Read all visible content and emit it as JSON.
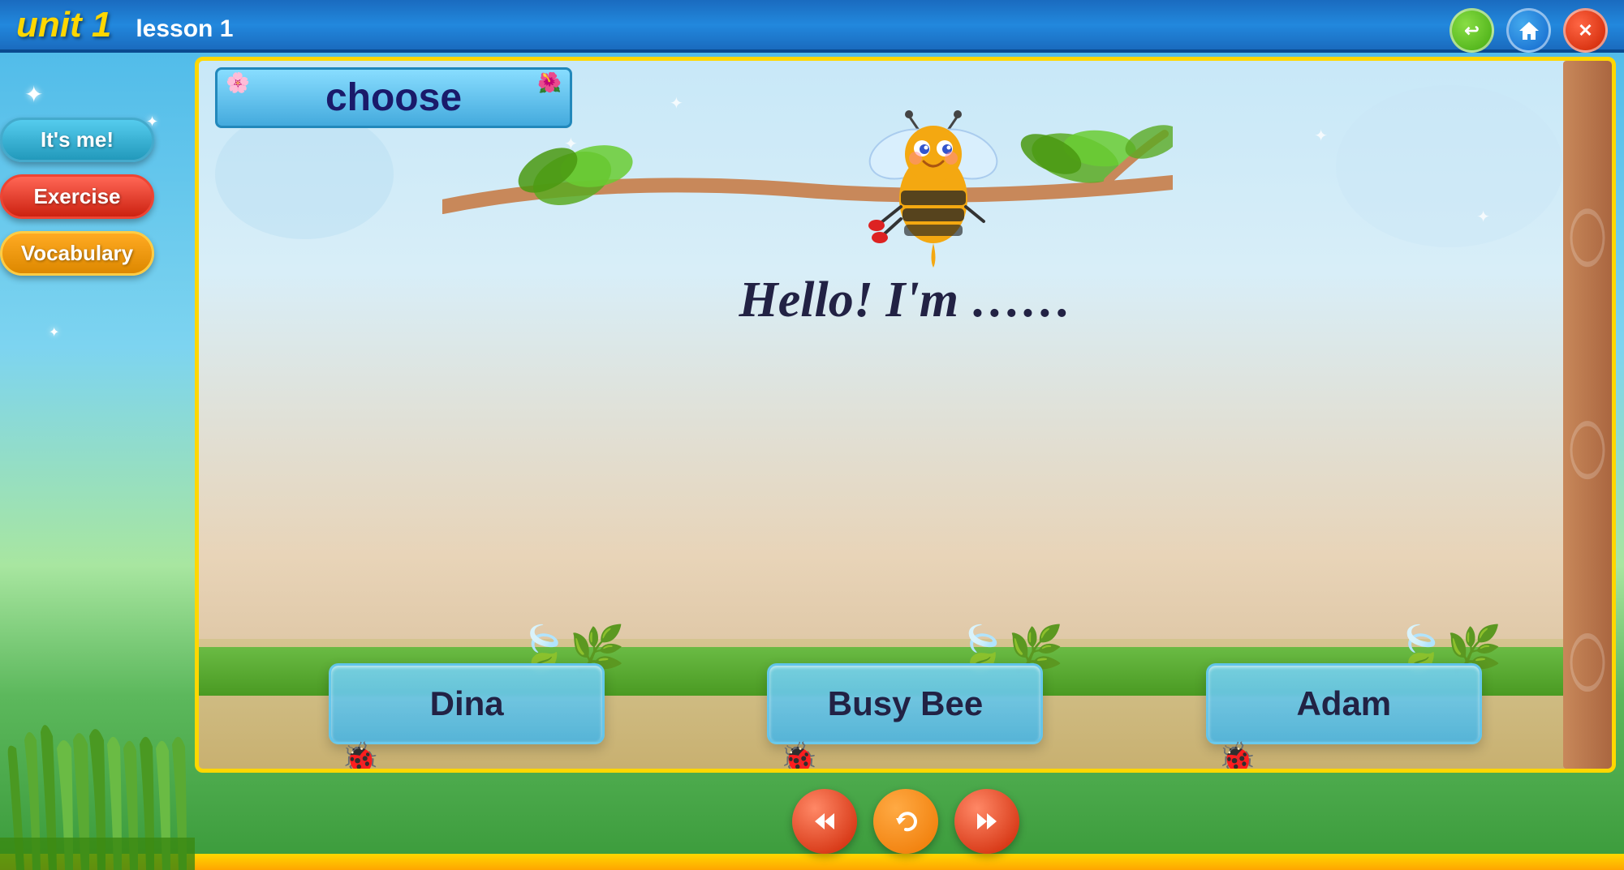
{
  "header": {
    "unit_label": "unit 1",
    "lesson_label": "lesson 1",
    "ctrl_back": "↩",
    "ctrl_home": "▲",
    "ctrl_close": "✕"
  },
  "sidebar": {
    "btn_itsme": "It's me!",
    "btn_exercise": "Exercise",
    "btn_vocabulary": "Vocabulary"
  },
  "main": {
    "choose_label": "choose",
    "hello_text": "Hello! I'm ……",
    "answer1": "Dina",
    "answer2": "Busy Bee",
    "answer3": "Adam"
  },
  "bottom_nav": {
    "rewind_label": "⏮",
    "refresh_label": "↺",
    "forward_label": "⏭"
  },
  "colors": {
    "header_bg": "#1a6bbf",
    "unit_color": "#FFD700",
    "border_gold": "#FFD700",
    "btn_itsme": "#44aacc",
    "btn_exercise": "#cc2211",
    "btn_vocab": "#dd8800"
  }
}
